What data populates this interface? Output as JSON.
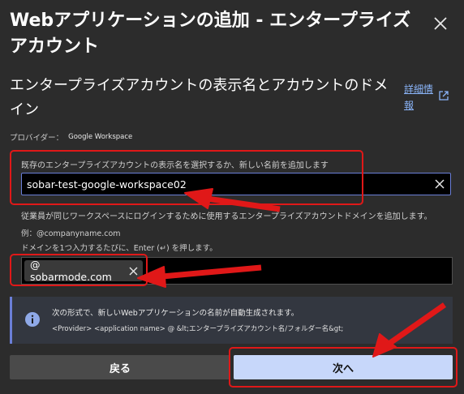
{
  "dialog": {
    "title": "Webアプリケーションの追加 - エンタープライズアカウント",
    "close_icon": "close-icon"
  },
  "section": {
    "title": "エンタープライズアカウントの表示名とアカウントのドメイン",
    "help_link": "詳細情報",
    "help_icon": "external-link-icon"
  },
  "provider": {
    "label": "プロバイダー：",
    "value": "Google Workspace"
  },
  "account_name": {
    "label": "既存のエンタープライズアカウントの表示名を選択するか、新しい名前を追加します",
    "value": "sobar-test-google-workspace02"
  },
  "domain": {
    "hint": "従業員が同じワークスペースにログインするために使用するエンタープライズアカウントドメインを追加します。",
    "example": "例：@companyname.com",
    "instruction": "ドメインを1つ入力するたびに、Enter (↵) を押します。",
    "tags": [
      "@ sobarmode.com"
    ]
  },
  "info": {
    "icon": "info-icon",
    "line1": "次の形式で、新しいWebアプリケーションの名前が自動生成されます。",
    "line2": "<Provider> <application name> @ &lt;エンタープライズアカウント名/フォルダー名&gt;"
  },
  "buttons": {
    "back": "戻る",
    "next": "次へ"
  },
  "colors": {
    "background": "#2c2c2c",
    "accent": "#6b7fd8",
    "primary_button": "#c7d7fa",
    "annotation": "#e01818"
  }
}
